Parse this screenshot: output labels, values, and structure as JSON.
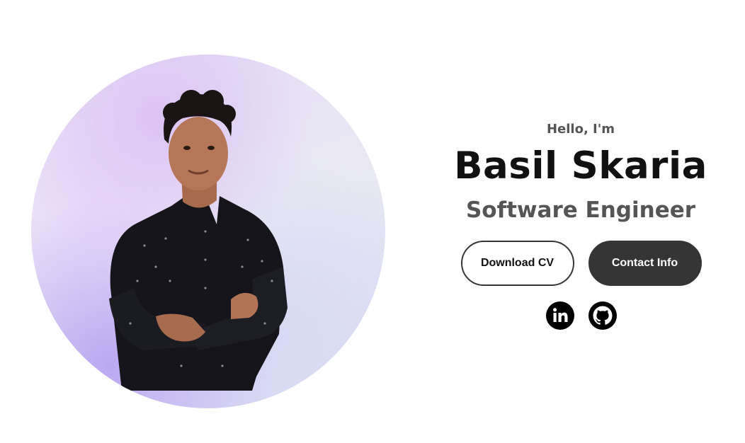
{
  "profile": {
    "image_alt": "profile-picture",
    "bg_colors": [
      "#dcc3f3",
      "#bba7f2",
      "#e9e9f3"
    ]
  },
  "hero": {
    "greeting": "Hello, I'm",
    "name": "Basil Skaria",
    "role": "Software Engineer"
  },
  "buttons": {
    "download_cv": "Download CV",
    "contact_info": "Contact Info"
  },
  "socials": [
    {
      "icon": "linkedin-icon",
      "label": "LinkedIn"
    },
    {
      "icon": "github-icon",
      "label": "GitHub"
    }
  ],
  "colors": {
    "dark": "#353535",
    "text_muted": "#555555",
    "text_dark": "#111111"
  }
}
